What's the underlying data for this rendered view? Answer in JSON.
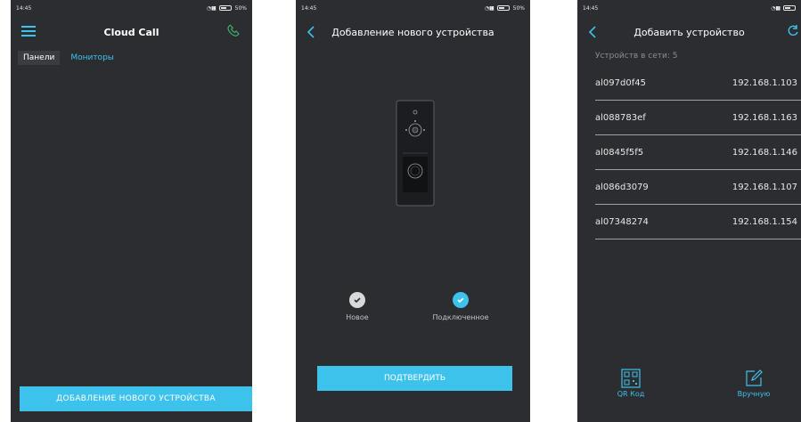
{
  "colors": {
    "accent": "#3dc2ec",
    "background": "#2b2d31",
    "phone_icon": "#3fae6a"
  },
  "screens": [
    {
      "status": {
        "time": "14:45",
        "battery": "50%"
      },
      "title": "Cloud Call",
      "tabs": [
        {
          "label": "Панели",
          "active": true
        },
        {
          "label": "Мониторы",
          "active": false
        }
      ],
      "bottom_button": "ДОБАВЛЕНИЕ НОВОГО УСТРОЙСТВА",
      "icons": [
        "menu-icon",
        "phone-icon"
      ]
    },
    {
      "status": {
        "time": "14:45",
        "battery": "50%"
      },
      "title": "Добавление нового устройства",
      "options": [
        {
          "label": "Новое",
          "state": "grey"
        },
        {
          "label": "Подключенное",
          "state": "blue"
        }
      ],
      "confirm_button": "ПОДТВЕРДИТЬ",
      "icons": [
        "back-icon",
        "doorbell-panel-icon",
        "check-icon"
      ]
    },
    {
      "status": {
        "time": "14:45"
      },
      "title": "Добавить устройство",
      "online_count": "Устройств в сети: 5",
      "devices": [
        {
          "id": "al097d0f45",
          "ip": "192.168.1.103"
        },
        {
          "id": "al088783ef",
          "ip": "192.168.1.163"
        },
        {
          "id": "al0845f5f5",
          "ip": "192.168.1.146"
        },
        {
          "id": "al086d3079",
          "ip": "192.168.1.107"
        },
        {
          "id": "al07348274",
          "ip": "192.168.1.154"
        }
      ],
      "actions": [
        {
          "label": "QR Код",
          "icon": "qr-code-icon"
        },
        {
          "label": "Вручную",
          "icon": "edit-icon"
        }
      ],
      "icons": [
        "back-icon",
        "refresh-icon"
      ]
    }
  ]
}
